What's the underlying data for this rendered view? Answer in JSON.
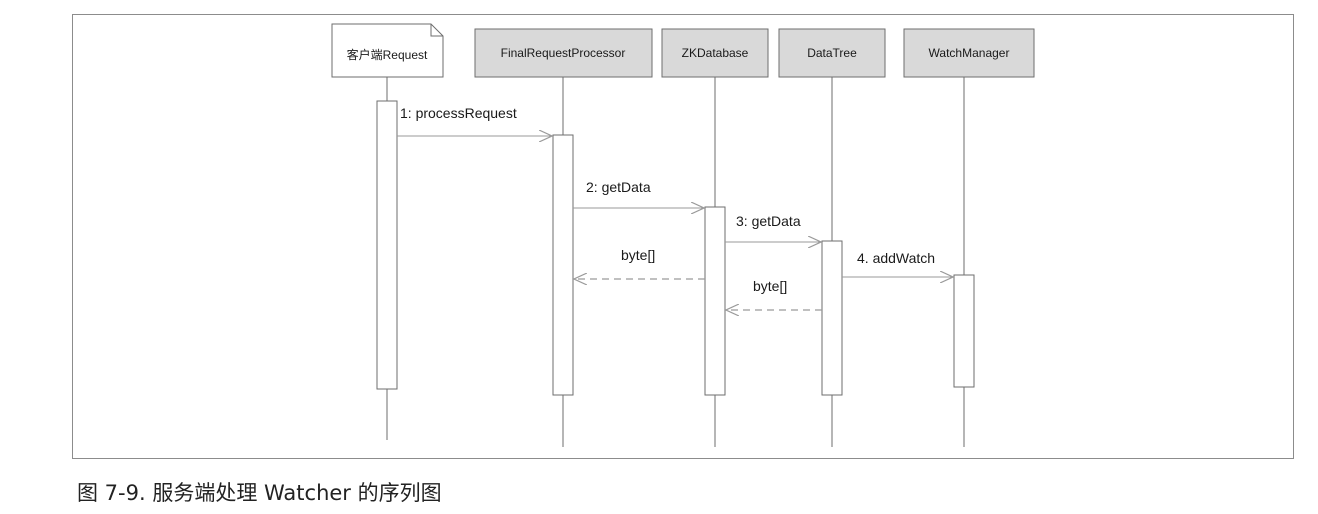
{
  "participants": [
    {
      "id": "client",
      "label": "客户端Request",
      "style": "note"
    },
    {
      "id": "frp",
      "label": "FinalRequestProcessor",
      "style": "box"
    },
    {
      "id": "zkdb",
      "label": "ZKDatabase",
      "style": "box"
    },
    {
      "id": "tree",
      "label": "DataTree",
      "style": "box"
    },
    {
      "id": "watch",
      "label": "WatchManager",
      "style": "box"
    }
  ],
  "messages": [
    {
      "label": "1: processRequest",
      "from": "client",
      "to": "frp",
      "kind": "call"
    },
    {
      "label": "2: getData",
      "from": "frp",
      "to": "zkdb",
      "kind": "call"
    },
    {
      "label": "3: getData",
      "from": "zkdb",
      "to": "tree",
      "kind": "call"
    },
    {
      "label": "4. addWatch",
      "from": "tree",
      "to": "watch",
      "kind": "call"
    },
    {
      "label": "byte[]",
      "from": "zkdb",
      "to": "frp",
      "kind": "return"
    },
    {
      "label": "byte[]",
      "from": "tree",
      "to": "zkdb",
      "kind": "return"
    }
  ],
  "caption": "图 7-9.  服务端处理 Watcher 的序列图",
  "colors": {
    "participant_fill": "#d9d9d9",
    "note_fill": "#ffffff",
    "line": "#6e6e6e",
    "arrow": "#9a9a9a",
    "text": "#1a1a1a"
  }
}
